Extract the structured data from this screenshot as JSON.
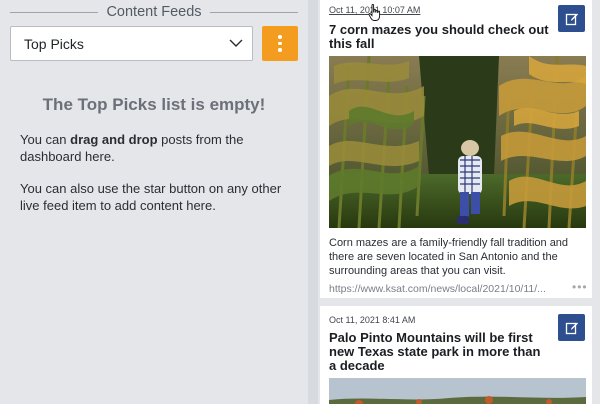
{
  "left": {
    "section_title": "Content Feeds",
    "select": {
      "value": "Top Picks"
    },
    "more_button_icon": "vertical-ellipsis-icon",
    "empty_title": "The Top Picks list is empty!",
    "empty_text_1_prefix": "You can ",
    "empty_text_1_bold": "drag and drop",
    "empty_text_1_suffix": " posts from the dashboard here.",
    "empty_text_2": "You can also use the star button on any other live feed item to add content here."
  },
  "feed": {
    "items": [
      {
        "date": "Oct 11, 2021 10:07 AM",
        "headline": "7 corn mazes you should check out this fall",
        "description": "Corn mazes are a family-friendly fall tradition and there are seven located in San Antonio and the surrounding areas that you can visit.",
        "link": "https://www.ksat.com/news/local/2021/10/11/...",
        "more": "•••",
        "edit_icon": "edit-icon"
      },
      {
        "date": "Oct 11, 2021 8:41 AM",
        "headline": "Palo Pinto Mountains will be first new Texas state park in more than a decade",
        "edit_icon": "edit-icon"
      }
    ]
  },
  "colors": {
    "accent_orange": "#f39c1f",
    "edit_blue": "#2e4f8f",
    "panel_bg": "#e4e6ea"
  }
}
